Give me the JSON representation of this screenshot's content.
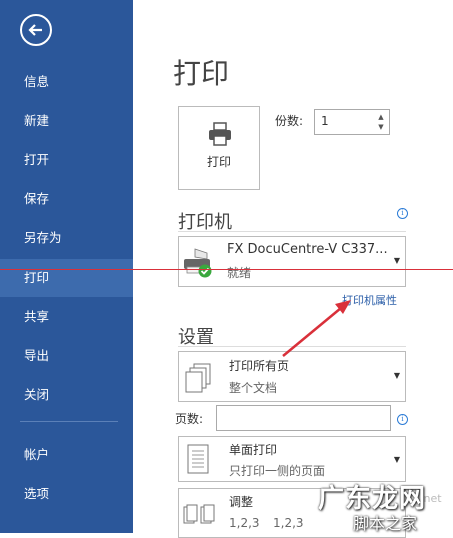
{
  "sidebar": {
    "items": [
      {
        "label": "信息"
      },
      {
        "label": "新建"
      },
      {
        "label": "打开"
      },
      {
        "label": "保存"
      },
      {
        "label": "另存为"
      },
      {
        "label": "打印"
      },
      {
        "label": "共享"
      },
      {
        "label": "导出"
      },
      {
        "label": "关闭"
      },
      {
        "label": "帐户"
      },
      {
        "label": "选项"
      }
    ],
    "active": "打印"
  },
  "main": {
    "title": "打印",
    "print_button": "打印",
    "copies_label": "份数:",
    "copies_value": "1",
    "printer_section": "打印机",
    "printer": {
      "name": "FX DocuCentre-V C337...",
      "status": "就绪"
    },
    "printer_properties_link": "打印机属性",
    "settings_section": "设置",
    "setting_pages": {
      "line1": "打印所有页",
      "line2": "整个文档"
    },
    "pages_label": "页数:",
    "pages_value": "",
    "setting_sides": {
      "line1": "单面打印",
      "line2": "只打印一侧的页面"
    },
    "setting_collate": {
      "line1": "调整",
      "line2a": "1,2,3",
      "line2b": "1,2,3"
    }
  },
  "watermark": {
    "text1": "广东龙网",
    "text2": "脚本之家",
    "text3": ".net"
  },
  "colors": {
    "sidebar": "#2b579a",
    "sidebar_active": "#3d6bad",
    "annotation": "#d9303a",
    "link": "#2b5ea8"
  }
}
